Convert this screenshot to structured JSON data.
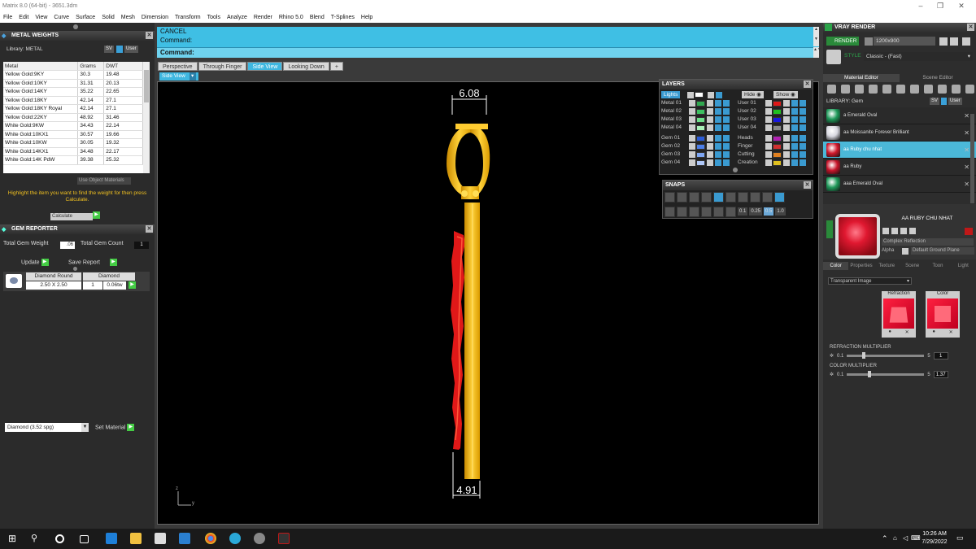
{
  "window": {
    "title": "Matrix 8.0 (64-bit) - 3651.3dm"
  },
  "menu": [
    "File",
    "Edit",
    "View",
    "Curve",
    "Surface",
    "Solid",
    "Mesh",
    "Dimension",
    "Transform",
    "Tools",
    "Analyze",
    "Render",
    "Rhino 5.0",
    "Blend",
    "T-Splines",
    "Help"
  ],
  "metal_weights": {
    "title": "METAL WEIGHTS",
    "library_label": "Library: METAL",
    "lib_sv": "SV",
    "lib_user": "User",
    "columns": [
      "Metal",
      "Grams",
      "DWT"
    ],
    "rows": [
      [
        "Yellow Gold:9KY",
        "30.3",
        "19.48"
      ],
      [
        "Yellow Gold:10KY",
        "31.31",
        "20.13"
      ],
      [
        "Yellow Gold:14KY",
        "35.22",
        "22.65"
      ],
      [
        "Yellow Gold:18KY",
        "42.14",
        "27.1"
      ],
      [
        "Yellow Gold:18KY Royal",
        "42.14",
        "27.1"
      ],
      [
        "Yellow Gold:22KY",
        "48.92",
        "31.46"
      ],
      [
        "White Gold:9KW",
        "34.43",
        "22.14"
      ],
      [
        "White Gold:10KX1",
        "30.57",
        "19.66"
      ],
      [
        "White Gold:10KW",
        "30.05",
        "19.32"
      ],
      [
        "White Gold:14KX1",
        "34.48",
        "22.17"
      ],
      [
        "White Gold:14K PdW",
        "39.38",
        "25.32"
      ]
    ],
    "use_object": "Use Object Materials",
    "hint": "Highlight the item you want to find the weight for then press Calculate.",
    "calculate": "Calculate"
  },
  "gem_reporter": {
    "title": "GEM REPORTER",
    "total_weight_label": "Total Gem Weight",
    "total_weight": ".06",
    "total_count_label": "Total Gem Count",
    "total_count": "1",
    "update": "Update",
    "save_report": "Save Report",
    "gem": {
      "cut": "Diamond Round",
      "size": "2.50 X 2.50",
      "material": "Diamond",
      "qty": "1",
      "weight": "0.06tw"
    }
  },
  "material_select": {
    "value": "Diamond    (3.52 spg)",
    "set_material": "Set Material"
  },
  "command": {
    "line1": "CANCEL",
    "line2": "Command:",
    "prompt": "Command:"
  },
  "view_tabs": [
    "Perspective",
    "Through Finger",
    "Side View",
    "Looking Down",
    "+"
  ],
  "active_view": "Side View",
  "viewport": {
    "dim_top": "6.08",
    "dim_bottom": "4.91",
    "axis_z": "z",
    "axis_y": "y"
  },
  "layers": {
    "title": "LAYERS",
    "lights": "Lights",
    "hide": "Hide",
    "show": "Show",
    "left": [
      {
        "name": "Metal 01",
        "color": "#2fa84f"
      },
      {
        "name": "Metal 02",
        "color": "#3cc060"
      },
      {
        "name": "Metal 03",
        "color": "#6de08a"
      },
      {
        "name": "Metal 04",
        "color": "#a9f0b8"
      },
      {
        "name": "Gem 01",
        "color": "#2a5bd8"
      },
      {
        "name": "Gem 02",
        "color": "#4c7ee8"
      },
      {
        "name": "Gem 03",
        "color": "#7ea6f2"
      },
      {
        "name": "Gem 04",
        "color": "#b0c8f8"
      }
    ],
    "right": [
      {
        "name": "User 01",
        "color": "#e01818"
      },
      {
        "name": "User 02",
        "color": "#20c020"
      },
      {
        "name": "User 03",
        "color": "#1818e0"
      },
      {
        "name": "User 04",
        "color": "#8a8a8a"
      },
      {
        "name": "Heads",
        "color": "#b020b0"
      },
      {
        "name": "Finger",
        "color": "#d03030"
      },
      {
        "name": "Cutting",
        "color": "#e08020"
      },
      {
        "name": "Creation",
        "color": "#e0c020"
      }
    ]
  },
  "snaps": {
    "title": "SNAPS",
    "values": [
      "0.1",
      "0.25",
      "0.5",
      "1.0"
    ]
  },
  "vray": {
    "title": "VRAY RENDER",
    "render": "RENDER",
    "resolution": "1200x900",
    "style_label": "STYLE",
    "style": "Classic - (Fast)",
    "tabs": [
      "Material Editor",
      "Scene Editor"
    ],
    "library": "LIBRARY: Gem",
    "lib_sv": "SV",
    "lib_user": "User",
    "materials": [
      {
        "name": "a Emerald Oval",
        "color": "#1f9a5a"
      },
      {
        "name": "aa Moissanite Forever Brilliant",
        "color": "#d8d8e0"
      },
      {
        "name": "aa Ruby chu nhat",
        "color": "#d0182c"
      },
      {
        "name": "aa Ruby",
        "color": "#c8142a"
      },
      {
        "name": "aaa Emerald Oval",
        "color": "#1f9a5a"
      }
    ],
    "selected_index": 2,
    "preview_name": "AA RUBY CHU NHAT",
    "complex_reflection": "Complex Reflection",
    "alpha": "Alpha",
    "default_ground": "Default Ground Plane",
    "prop_tabs": [
      "Color",
      "Properties",
      "Texture",
      "Scene",
      "Toon",
      "Light"
    ],
    "transparent": "Transparent Image",
    "refraction_label": "Refraction",
    "color_label": "Color",
    "refraction_multiplier": {
      "label": "REFRACTION MULTIPLIER",
      "min": "0.1",
      "max": "5",
      "value": "1",
      "fraction": 0.2
    },
    "color_multiplier": {
      "label": "COLOR MULTIPLIER",
      "min": "0.1",
      "max": "5",
      "value": "1.37",
      "fraction": 0.27
    }
  },
  "taskbar": {
    "time": "10:26 AM",
    "date": "7/29/2022"
  }
}
